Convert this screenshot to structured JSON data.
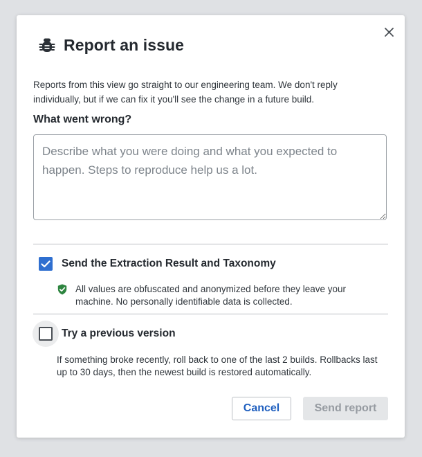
{
  "dialog": {
    "title": "Report an issue",
    "intro": "Reports from this view go straight to our engineering team. We don't reply individually, but if we can fix it you'll see the change in a future build.",
    "field_label": "What went wrong?",
    "textarea": {
      "value": "",
      "placeholder": "Describe what you were doing and what you expected to happen. Steps to reproduce help us a lot."
    },
    "options": [
      {
        "label": "Send the Extraction Result and Taxonomy",
        "checked": true,
        "note": "All values are obfuscated and anonymized before they leave your machine. No personally identifiable data is collected.",
        "note_icon": "shield-check-icon"
      },
      {
        "label": "Try a previous version",
        "checked": false,
        "note": "If something broke recently, roll back to one of the last 2 builds. Rollbacks last up to 30 days, then the newest build is restored automatically."
      }
    ],
    "buttons": {
      "cancel": "Cancel",
      "send": "Send report"
    }
  },
  "icons": {
    "title_icon": "bug-icon",
    "close_icon": "close-icon"
  },
  "colors": {
    "accent": "#2f6fd0",
    "link_text": "#1f5fbf",
    "shield_green": "#2e8540",
    "disabled_bg": "#e4e6e8",
    "disabled_text": "#969ba1"
  }
}
